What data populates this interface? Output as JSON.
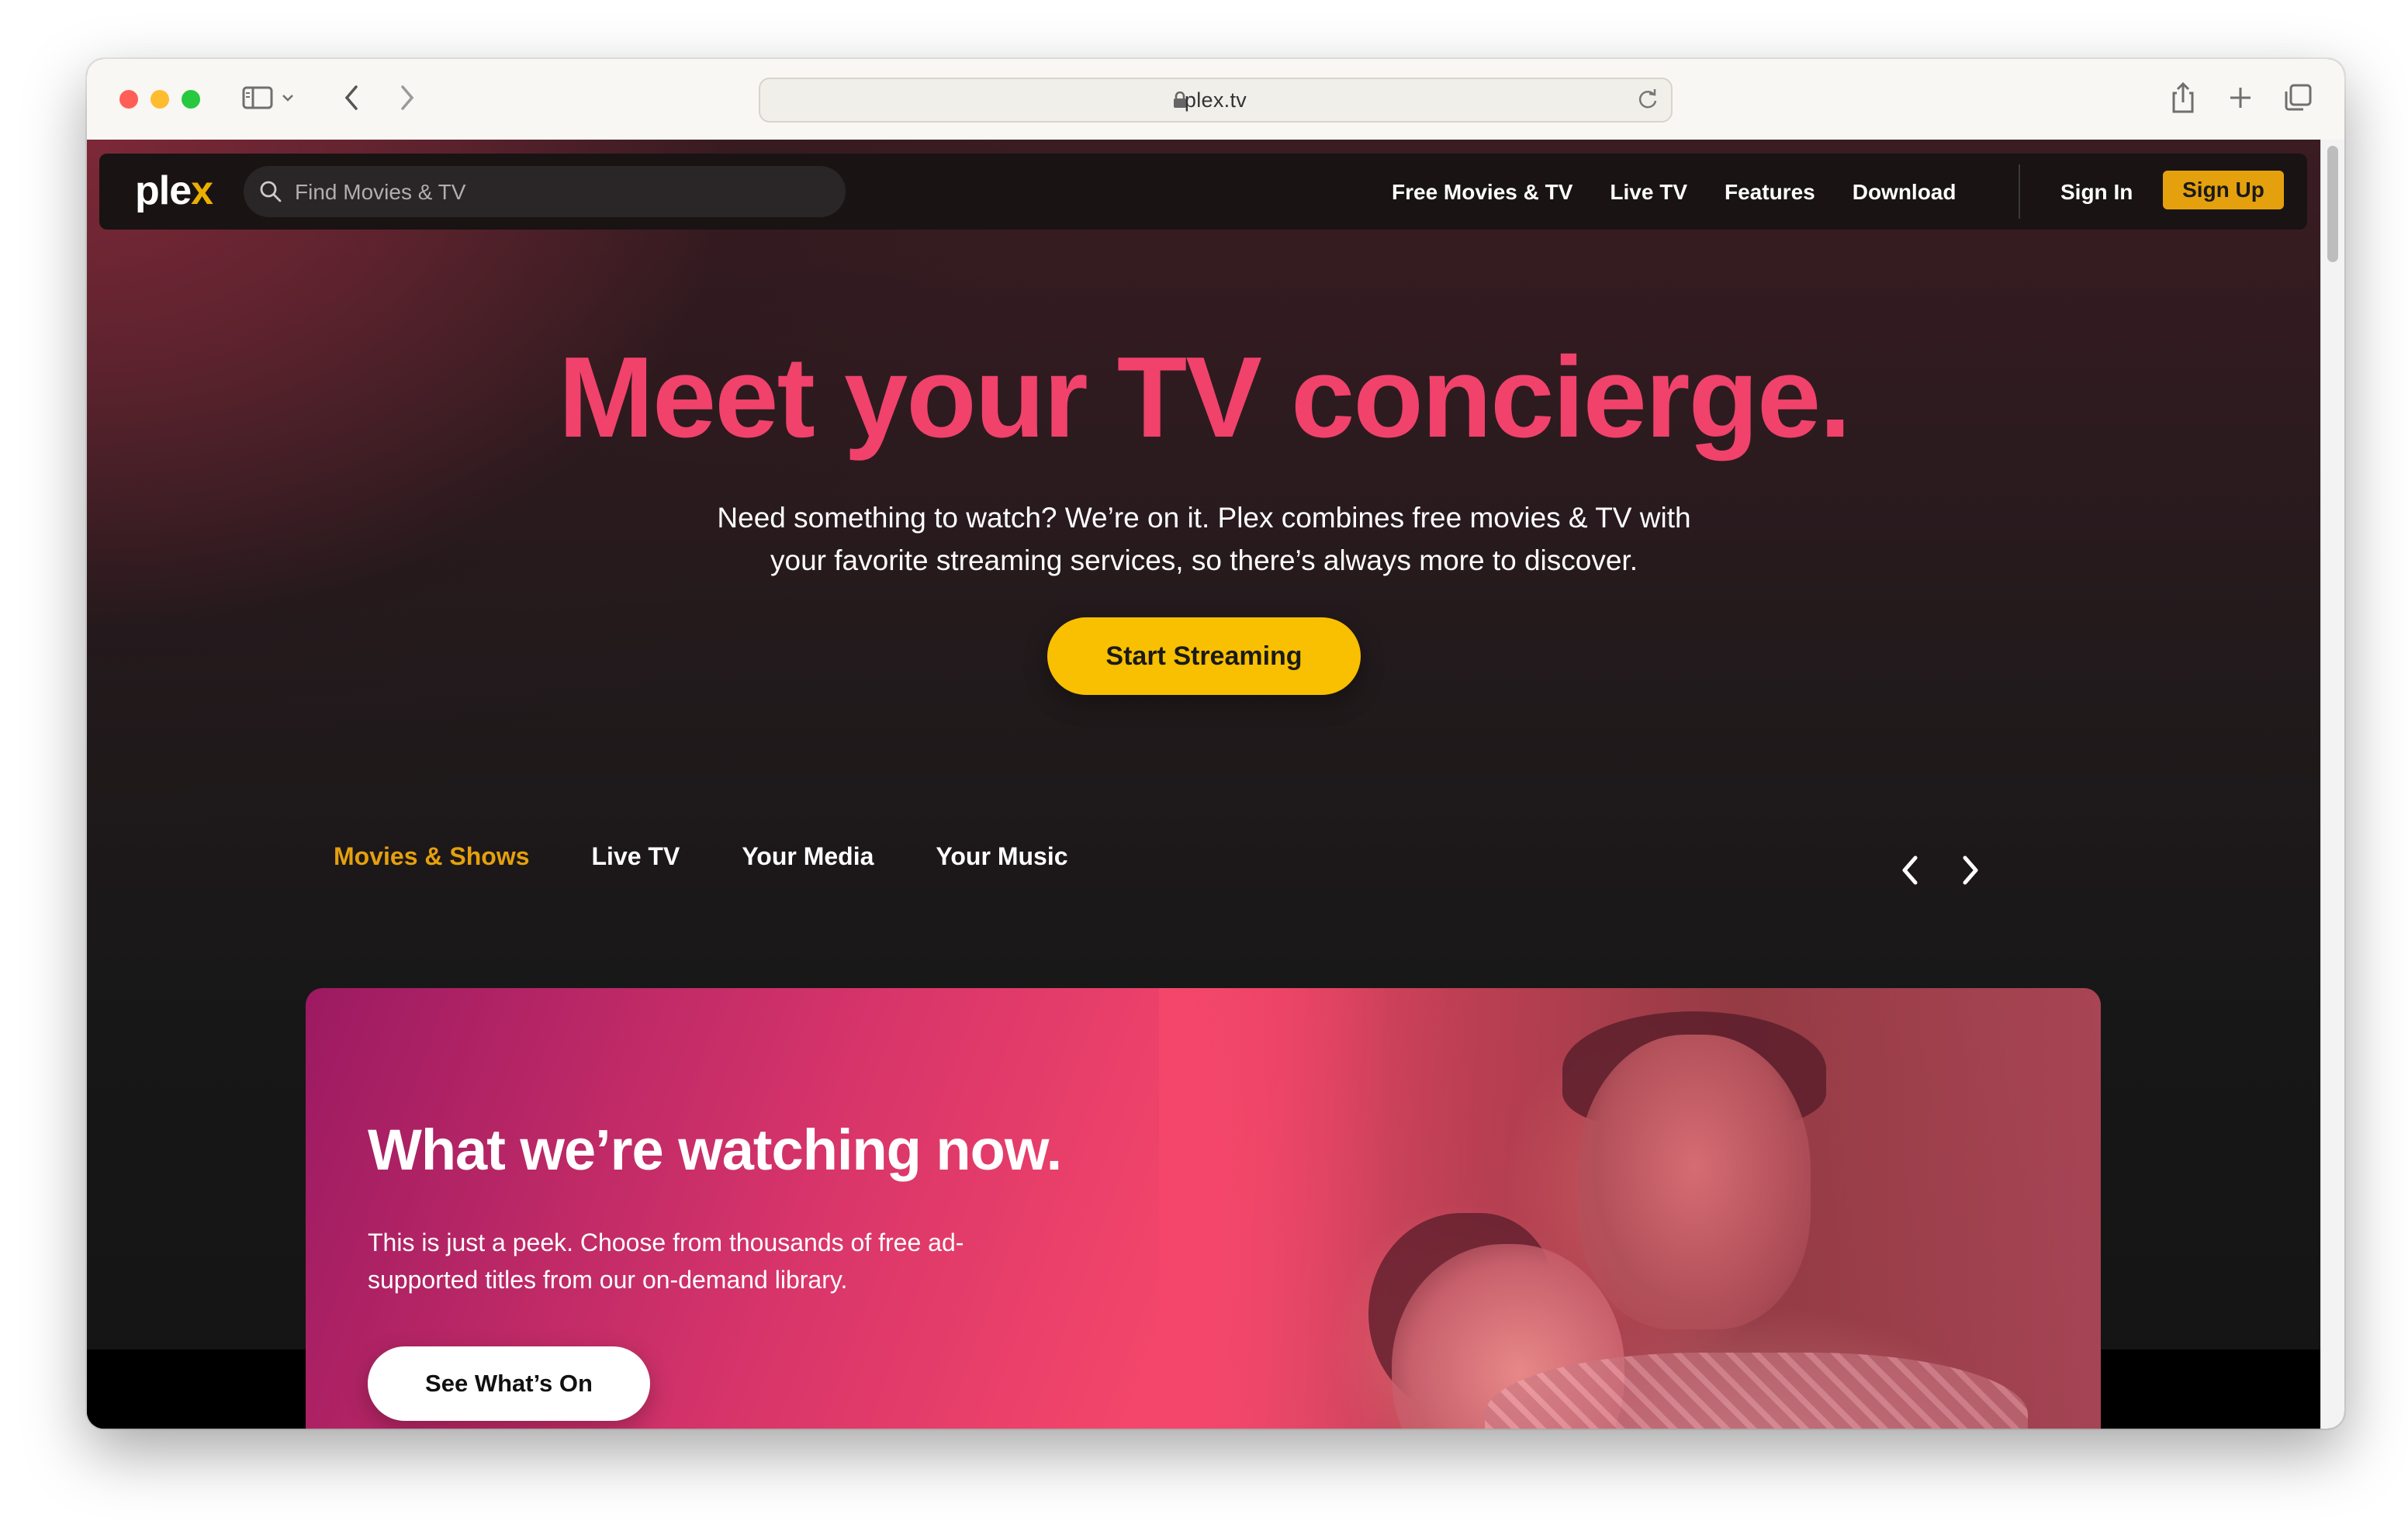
{
  "browser": {
    "url": "plex.tv"
  },
  "nav": {
    "logo": {
      "text": "ple",
      "accent": "x"
    },
    "search_placeholder": "Find Movies & TV",
    "links": [
      "Free Movies & TV",
      "Live TV",
      "Features",
      "Download"
    ],
    "sign_in": "Sign In",
    "sign_up": "Sign Up"
  },
  "hero": {
    "title": "Meet your TV concierge.",
    "subtitle_line1": "Need something to watch? We’re on it. Plex combines free movies & TV with",
    "subtitle_line2": "your favorite streaming services, so there’s always more to discover.",
    "cta": "Start Streaming"
  },
  "tabs": [
    {
      "label": "Movies & Shows",
      "active": true
    },
    {
      "label": "Live TV",
      "active": false
    },
    {
      "label": "Your Media",
      "active": false
    },
    {
      "label": "Your Music",
      "active": false
    }
  ],
  "card": {
    "title": "What we’re watching now.",
    "text": "This is just a peek. Choose from thousands of free ad-supported titles from our on-demand library.",
    "button": "See What’s On"
  },
  "colors": {
    "brand_pink": "#f0426b",
    "brand_yellow": "#f8c000",
    "plex_gold": "#e5a00d"
  },
  "icons": [
    "sidebar-icon",
    "chevron-down-icon",
    "back-icon",
    "forward-icon",
    "lock-icon",
    "reload-icon",
    "share-icon",
    "new-tab-icon",
    "tabs-overview-icon",
    "search-icon",
    "carousel-prev-icon",
    "carousel-next-icon"
  ]
}
